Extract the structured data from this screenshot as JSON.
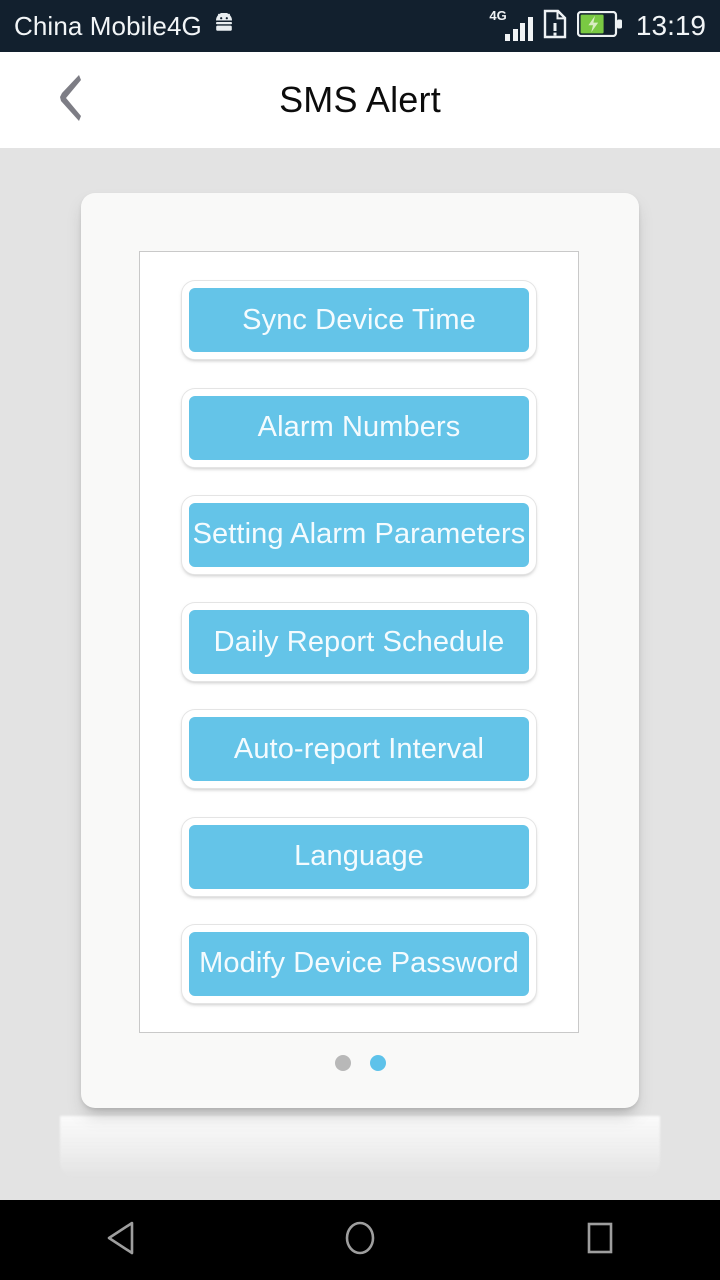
{
  "status_bar": {
    "carrier": "China Mobile4G",
    "android_icon": "android-robot-icon",
    "network_type": "4G",
    "signal_icon": "signal-bars-icon",
    "sim_icon": "sim-card-alert-icon",
    "battery_icon": "battery-charging-icon",
    "clock": "13:19",
    "background_color": "#12202e",
    "text_color": "#f2f5f7",
    "battery_color": "#7ac943"
  },
  "header": {
    "title": "SMS Alert",
    "back_icon": "chevron-left-icon",
    "back_icon_color": "#7d7d85",
    "background_color": "#ffffff",
    "title_color": "#0c0c0c"
  },
  "main": {
    "background_color": "#e3e3e3",
    "card_color": "#f9f9f8",
    "panel_color": "#ffffff",
    "accent_color": "#64c4e8",
    "buttons": [
      {
        "label": "Sync Device Time",
        "name": "sync-device-time-button"
      },
      {
        "label": "Alarm Numbers",
        "name": "alarm-numbers-button"
      },
      {
        "label": "Setting Alarm Parameters",
        "name": "setting-alarm-parameters-button"
      },
      {
        "label": "Daily Report Schedule",
        "name": "daily-report-schedule-button"
      },
      {
        "label": "Auto-report Interval",
        "name": "auto-report-interval-button"
      },
      {
        "label": "Language",
        "name": "language-button"
      },
      {
        "label": "Modify Device Password",
        "name": "modify-device-password-button"
      }
    ],
    "page_indicator": {
      "total": 2,
      "active_index": 1,
      "inactive_color": "#b8b8b8",
      "active_color": "#5ec2ea"
    }
  },
  "nav_bar": {
    "background_color": "#000000",
    "icon_color": "#9e9e9e",
    "buttons": [
      {
        "name": "nav-back-button",
        "icon": "triangle-back-icon"
      },
      {
        "name": "nav-home-button",
        "icon": "circle-home-icon"
      },
      {
        "name": "nav-recents-button",
        "icon": "square-recents-icon"
      }
    ]
  }
}
